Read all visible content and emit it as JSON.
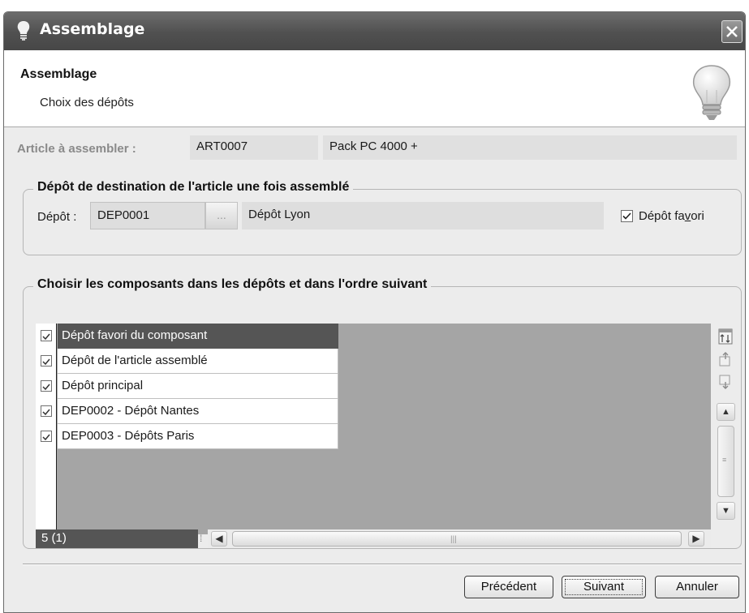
{
  "window": {
    "title": "Assemblage"
  },
  "header": {
    "title": "Assemblage",
    "subtitle": "Choix des dépôts"
  },
  "article": {
    "label": "Article à assembler :",
    "code": "ART0007",
    "name": "Pack PC 4000 +"
  },
  "destination": {
    "legend": "Dépôt de destination de l'article une fois assemblé",
    "depot_label": "Dépôt :",
    "depot_code": "DEP0001",
    "browse_label": "...",
    "depot_name": "Dépôt Lyon",
    "favorite_label_prefix": "Dépôt fa",
    "favorite_label_accel": "v",
    "favorite_label_suffix": "ori",
    "favorite_checked": true
  },
  "components": {
    "legend": "Choisir les composants dans les dépôts et dans l'ordre suivant",
    "rows": [
      {
        "label": "Dépôt favori du composant",
        "checked": true,
        "selected": true
      },
      {
        "label": "Dépôt de l'article assemblé",
        "checked": true,
        "selected": false
      },
      {
        "label": "Dépôt principal",
        "checked": true,
        "selected": false
      },
      {
        "label": "DEP0002 - Dépôt Nantes",
        "checked": true,
        "selected": false
      },
      {
        "label": "DEP0003 - Dépôts Paris",
        "checked": true,
        "selected": false
      }
    ],
    "count": "5 (1)"
  },
  "buttons": {
    "previous": "Précédent",
    "next": "Suivant",
    "cancel": "Annuler"
  },
  "colors": {
    "selected_row": "#555555",
    "list_background": "#a5a5a5",
    "title_bar": "#505050"
  },
  "icons": {
    "window": "lightbulb-icon",
    "header": "lightbulb-icon",
    "close": "close-icon",
    "side_tools": [
      "reorder-icon",
      "move-up-icon",
      "move-down-icon"
    ]
  }
}
